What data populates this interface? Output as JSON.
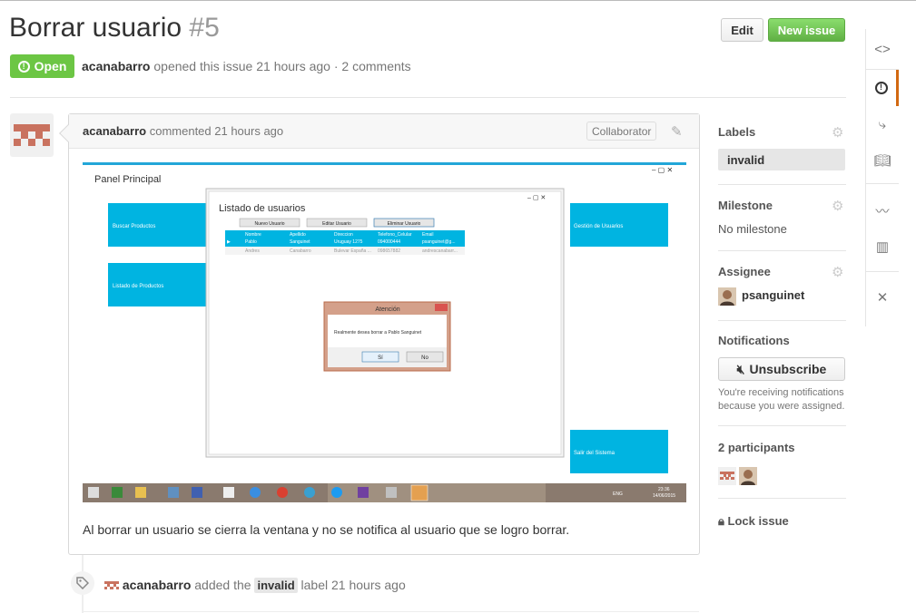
{
  "issue": {
    "title": "Borrar usuario",
    "number": "#5",
    "state": "Open",
    "author": "acanabarro",
    "meta_text": "opened this issue 21 hours ago · 2 comments"
  },
  "header": {
    "edit_label": "Edit",
    "new_issue_label": "New issue"
  },
  "comment": {
    "author": "acanabarro",
    "time": "commented 21 hours ago",
    "badge": "Collaborator",
    "body": "Al borrar un usuario se cierra la ventana y no se notifica al usuario que se logro borrar."
  },
  "screenshot": {
    "main_title": "Panel Principal",
    "tiles": [
      "Buscar Productos",
      "Listado de Productos",
      "Gestión de Usuarios",
      "Salir del Sistema"
    ],
    "dialog_title": "Listado de usuarios",
    "buttons": [
      "Nuevo Usuario",
      "Editar Usuario",
      "Eliminar Usuario"
    ],
    "columns": [
      "Nombre",
      "Apellido",
      "Direccion",
      "Telefono_Celular",
      "Email"
    ],
    "rows": [
      [
        "Pablo",
        "Sanguinet",
        "Uruguay 1275",
        "094000444",
        "psanguinet@g..."
      ],
      [
        "Andres",
        "Canabarro",
        "Bulevar España ...",
        "098657882",
        "andrescanabarr..."
      ]
    ],
    "alert_title": "Atención",
    "alert_text": "Realmente desea borrar a Pablo Sanguinet",
    "alert_yes": "Sí",
    "alert_no": "No",
    "clock_time": "23:36",
    "clock_date": "14/06/2015",
    "lang": "ENG"
  },
  "event": {
    "actor": "acanabarro",
    "pre": "added the",
    "label": "invalid",
    "post": "label 21 hours ago"
  },
  "sidebar": {
    "labels_heading": "Labels",
    "label_value": "invalid",
    "milestone_heading": "Milestone",
    "milestone_value": "No milestone",
    "assignee_heading": "Assignee",
    "assignee_value": "psanguinet",
    "notifications_heading": "Notifications",
    "unsubscribe_label": "Unsubscribe",
    "notifications_note": "You're receiving notifications because you were assigned.",
    "participants_heading": "2 participants",
    "lock_label": "Lock issue"
  },
  "colors": {
    "open_green": "#6cc644",
    "tile_blue": "#00b4e1",
    "active_tab": "#d26911"
  },
  "rail_icons": [
    "code-icon",
    "issue-opened-icon",
    "pull-request-icon",
    "book-icon",
    "pulse-icon",
    "graph-icon",
    "tools-icon"
  ]
}
